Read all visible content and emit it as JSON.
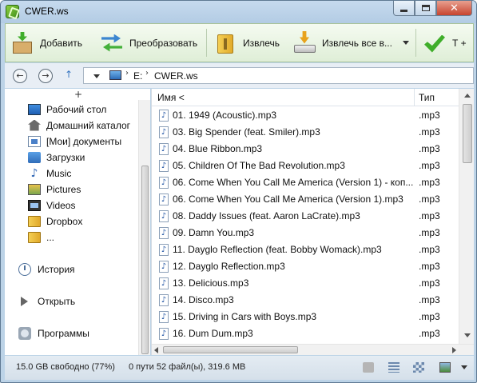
{
  "window": {
    "title": "CWER.ws"
  },
  "toolbar": {
    "add_label": "Добавить",
    "convert_label": "Преобразовать",
    "extract_label": "Извлечь",
    "extract_all_label": "Извлечь все в...",
    "test_label": "Т +"
  },
  "address": {
    "crumbs": [
      "E:",
      "CWER.ws"
    ]
  },
  "sidebar": {
    "expander": "+",
    "items": [
      {
        "label": "Рабочий стол",
        "icon": "desktop-icon"
      },
      {
        "label": "Домашний каталог",
        "icon": "home-icon"
      },
      {
        "label": "[Мои] документы",
        "icon": "documents-icon"
      },
      {
        "label": "Загрузки",
        "icon": "downloads-icon"
      },
      {
        "label": "Music",
        "icon": "music-icon"
      },
      {
        "label": "Pictures",
        "icon": "pictures-icon"
      },
      {
        "label": "Videos",
        "icon": "videos-icon"
      },
      {
        "label": "Dropbox",
        "icon": "folder-icon"
      },
      {
        "label": "...",
        "icon": "folder-icon"
      }
    ],
    "actions": [
      {
        "label": "История",
        "icon": "history-icon"
      },
      {
        "label": "Открыть",
        "icon": "play-icon"
      },
      {
        "label": "Программы",
        "icon": "programs-icon"
      }
    ]
  },
  "filelist": {
    "columns": {
      "name": "Имя <",
      "type": "Тип"
    },
    "rows": [
      {
        "name": "01. 1949 (Acoustic).mp3",
        "type": ".mp3"
      },
      {
        "name": "03. Big Spender (feat. Smiler).mp3",
        "type": ".mp3"
      },
      {
        "name": "04. Blue Ribbon.mp3",
        "type": ".mp3"
      },
      {
        "name": "05. Children Of The Bad Revolution.mp3",
        "type": ".mp3"
      },
      {
        "name": "06. Come When You Call Me America (Version 1) - коп...",
        "type": ".mp3"
      },
      {
        "name": "06. Come When You Call Me America (Version 1).mp3",
        "type": ".mp3"
      },
      {
        "name": "08. Daddy Issues (feat. Aaron LaCrate).mp3",
        "type": ".mp3"
      },
      {
        "name": "09. Damn You.mp3",
        "type": ".mp3"
      },
      {
        "name": "11. Dayglo Reflection (feat. Bobby Womack).mp3",
        "type": ".mp3"
      },
      {
        "name": "12. Dayglo Reflection.mp3",
        "type": ".mp3"
      },
      {
        "name": "13. Delicious.mp3",
        "type": ".mp3"
      },
      {
        "name": "14. Disco.mp3",
        "type": ".mp3"
      },
      {
        "name": "15. Driving in Cars with Boys.mp3",
        "type": ".mp3"
      },
      {
        "name": "16. Dum Dum.mp3",
        "type": ".mp3"
      }
    ]
  },
  "status": {
    "free_space": "15.0 GB свободно (77%)",
    "summary": "0 пути 52 файл(ы), 319.6 MB"
  },
  "colors": {
    "titlebar": "#bcd3e7",
    "toolbar_bg": "#e6f2df",
    "close_button": "#c7442f",
    "link_blue": "#2b63b3"
  }
}
